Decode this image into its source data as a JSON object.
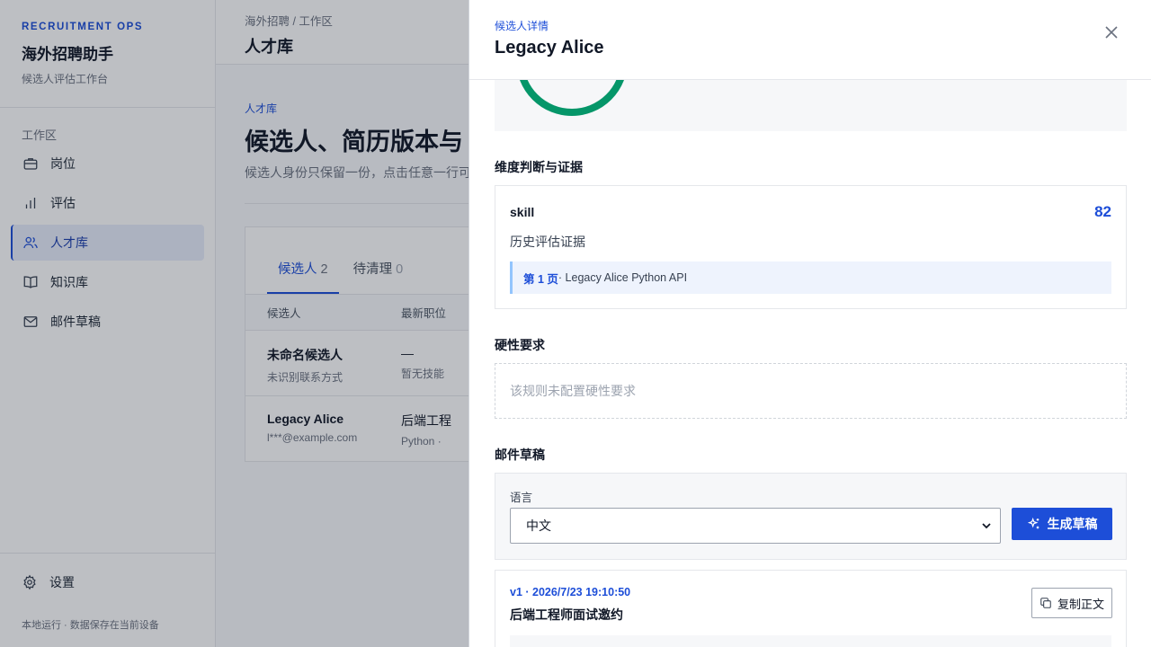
{
  "colors": {
    "accent": "#1d4ed8",
    "score_ring": "#059669"
  },
  "sidebar": {
    "eyebrow": "RECRUITMENT OPS",
    "title": "海外招聘助手",
    "subtitle": "候选人评估工作台",
    "section_label": "工作区",
    "items": [
      {
        "label": "岗位",
        "icon": "briefcase-icon"
      },
      {
        "label": "评估",
        "icon": "bar-chart-icon"
      },
      {
        "label": "人才库",
        "icon": "users-icon",
        "active": true
      },
      {
        "label": "知识库",
        "icon": "book-icon"
      },
      {
        "label": "邮件草稿",
        "icon": "mail-icon"
      }
    ],
    "settings_label": "设置",
    "footer": "本地运行 · 数据保存在当前设备"
  },
  "header": {
    "breadcrumb": "海外招聘 / 工作区",
    "title": "人才库"
  },
  "page": {
    "eyebrow": "人才库",
    "heading": "候选人、简历版本与",
    "description": "候选人身份只保留一份，点击任意一行可"
  },
  "tabs": [
    {
      "label": "候选人",
      "count": "2",
      "active": true
    },
    {
      "label": "待清理",
      "count": "0"
    }
  ],
  "table": {
    "columns": [
      "候选人",
      "最新职位"
    ],
    "rows": [
      {
        "name": "未命名候选人",
        "contact": "未识别联系方式",
        "position": "—",
        "skills": "暂无技能"
      },
      {
        "name": "Legacy Alice",
        "contact": "l***@example.com",
        "position": "后端工程",
        "skills": "Python ·"
      }
    ]
  },
  "drawer": {
    "eyebrow": "候选人详情",
    "title": "Legacy Alice",
    "dimensions_title": "维度判断与证据",
    "dimension": {
      "name": "skill",
      "score": "82",
      "description": "历史评估证据",
      "evidence_page": "第 1 页",
      "evidence_text": " · Legacy Alice Python API"
    },
    "hard_req_title": "硬性要求",
    "hard_req_empty": "该规则未配置硬性要求",
    "mail_title": "邮件草稿",
    "language_label": "语言",
    "language_value": "中文",
    "generate_label": "生成草稿",
    "draft": {
      "meta": "v1 · 2026/7/23 19:10:50",
      "title": "后端工程师面试邀约",
      "copy_label": "复制正文"
    }
  }
}
